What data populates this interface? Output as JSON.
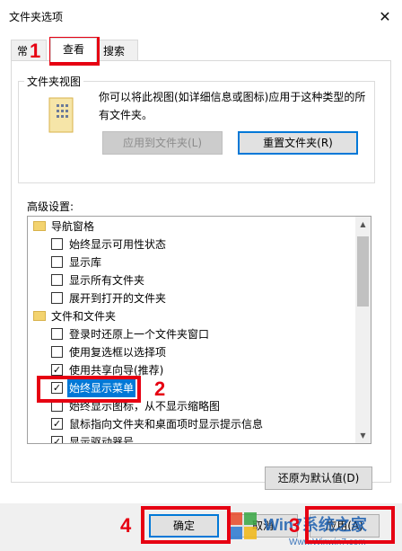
{
  "window": {
    "title": "文件夹选项",
    "close_label": "✕"
  },
  "tabs": [
    {
      "label": "常规",
      "shown": "常"
    },
    {
      "label": "查看"
    },
    {
      "label": "搜索"
    }
  ],
  "folder_view": {
    "legend": "文件夹视图",
    "description": "你可以将此视图(如详细信息或图标)应用于这种类型的所有文件夹。",
    "apply_button": "应用到文件夹(L)",
    "reset_button": "重置文件夹(R)"
  },
  "advanced": {
    "label": "高级设置:",
    "items": [
      {
        "type": "group",
        "label": "导航窗格"
      },
      {
        "type": "check",
        "label": "始终显示可用性状态",
        "checked": false
      },
      {
        "type": "check",
        "label": "显示库",
        "checked": false
      },
      {
        "type": "check",
        "label": "显示所有文件夹",
        "checked": false
      },
      {
        "type": "check",
        "label": "展开到打开的文件夹",
        "checked": false
      },
      {
        "type": "group",
        "label": "文件和文件夹"
      },
      {
        "type": "check",
        "label": "登录时还原上一个文件夹窗口",
        "checked": false
      },
      {
        "type": "check",
        "label": "使用复选框以选择项",
        "checked": false
      },
      {
        "type": "check",
        "label": "使用共享向导(推荐)",
        "checked": true
      },
      {
        "type": "check",
        "label": "始终显示菜单",
        "checked": true,
        "selected": true
      },
      {
        "type": "check",
        "label": "始终显示图标，从不显示缩略图",
        "checked": false
      },
      {
        "type": "check",
        "label": "鼠标指向文件夹和桌面项时显示提示信息",
        "checked": true
      },
      {
        "type": "check",
        "label": "显示驱动器号",
        "checked": true
      }
    ],
    "restore_button": "还原为默认值(D)"
  },
  "buttons": {
    "ok": "确定",
    "cancel": "取消",
    "apply": "应用(A)"
  },
  "annotations": {
    "n1": "1",
    "n2": "2",
    "n3": "3",
    "n4": "4"
  },
  "watermark": {
    "brand": "Win7系统之家",
    "url": "Www.Winwin7.com"
  },
  "colors": {
    "annotation_red": "#e60012",
    "selection_blue": "#0078d7"
  }
}
